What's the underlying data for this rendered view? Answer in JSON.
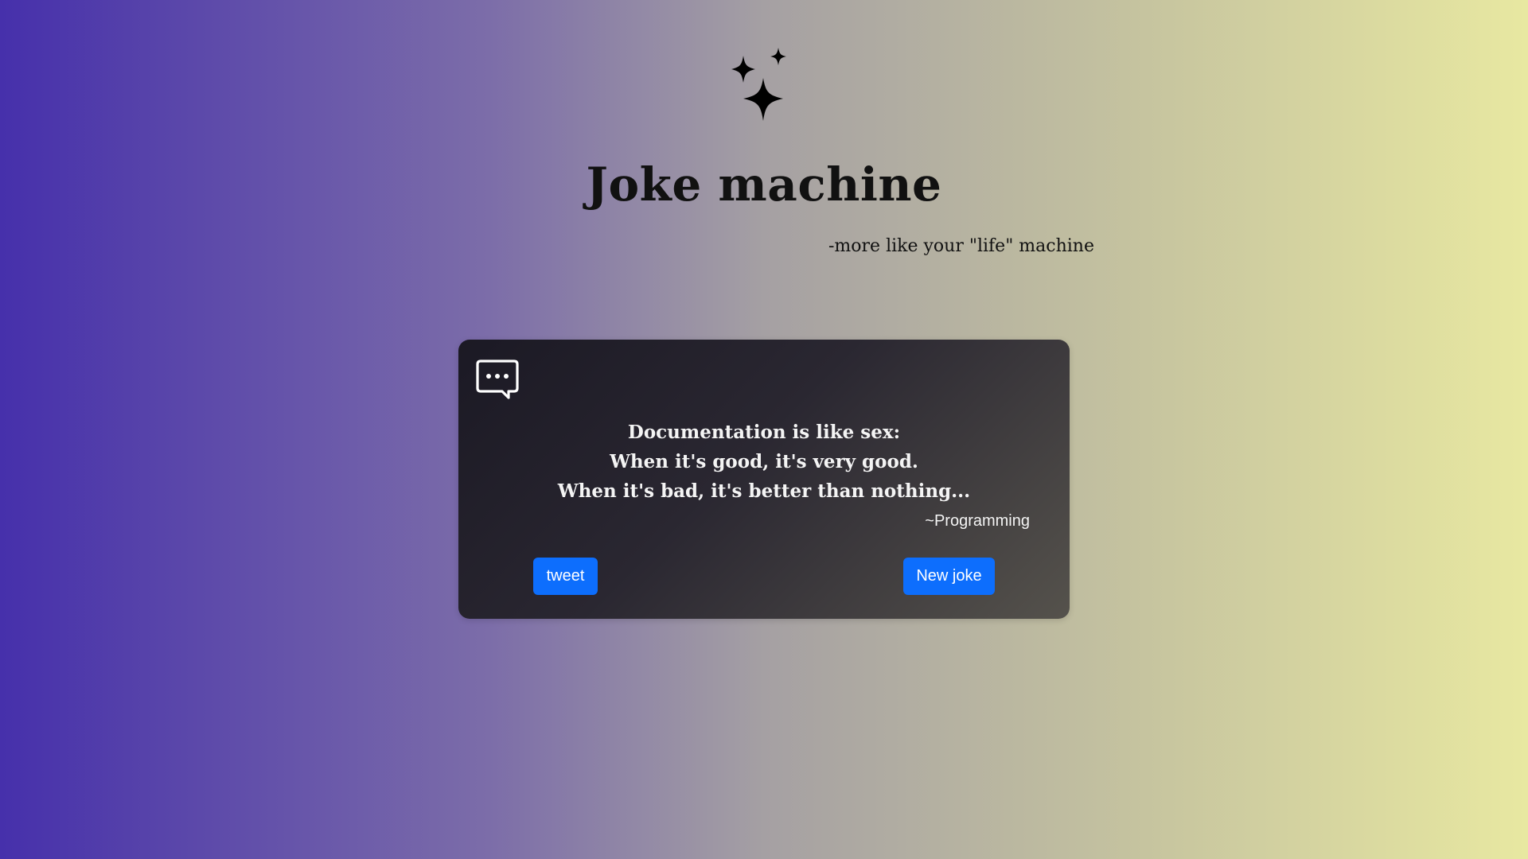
{
  "header": {
    "logo_icon": "sparkles-icon",
    "title": "Joke machine",
    "subtitle": "-more like your \"life\" machine"
  },
  "card": {
    "icon": "chat-bubble-icon",
    "joke_lines": [
      "Documentation is like sex:",
      "When it's good, it's very good.",
      "When it's bad, it's better than nothing..."
    ],
    "category": "~Programming",
    "tweet_label": "tweet",
    "new_joke_label": "New joke"
  },
  "colors": {
    "gradient_start": "#4630ab",
    "gradient_end": "#e8e8a1",
    "button": "#0d6efd",
    "card_dark": "#1b1924"
  }
}
